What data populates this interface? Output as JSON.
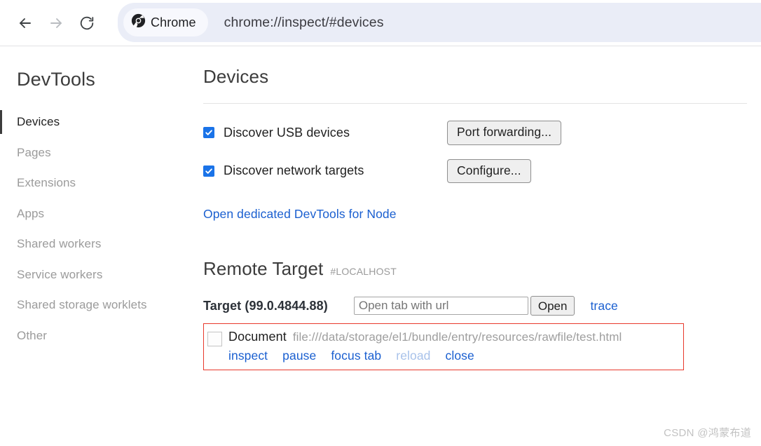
{
  "browser": {
    "back_icon": "arrow-left-icon",
    "forward_icon": "arrow-right-icon",
    "reload_icon": "reload-icon",
    "chrome_chip_label": "Chrome",
    "chrome_logo_icon": "chrome-logo-icon",
    "url": "chrome://inspect/#devices",
    "omnibox_bg": "#eaedf7",
    "chip_bg": "#f7f8fd"
  },
  "sidebar": {
    "brand": "DevTools",
    "items": [
      {
        "label": "Devices",
        "active": true
      },
      {
        "label": "Pages",
        "active": false
      },
      {
        "label": "Extensions",
        "active": false
      },
      {
        "label": "Apps",
        "active": false
      },
      {
        "label": "Shared workers",
        "active": false
      },
      {
        "label": "Service workers",
        "active": false
      },
      {
        "label": "Shared storage worklets",
        "active": false
      },
      {
        "label": "Other",
        "active": false
      }
    ]
  },
  "devices": {
    "title": "Devices",
    "options": [
      {
        "label": "Discover USB devices",
        "checked": true,
        "button": "Port forwarding..."
      },
      {
        "label": "Discover network targets",
        "checked": true,
        "button": "Configure..."
      }
    ],
    "node_link": "Open dedicated DevTools for Node"
  },
  "remote_target": {
    "heading": "Remote Target",
    "host": "#LOCALHOST",
    "target_name": "Target (99.0.4844.88)",
    "url_placeholder": "Open tab with url",
    "url_value": "",
    "open_button": "Open",
    "trace_link": "trace",
    "card": {
      "favicon": "favicon-placeholder-icon",
      "doc_title": "Document",
      "doc_url": "file:///data/storage/el1/bundle/entry/resources/rawfile/test.html",
      "border_color": "#e8392c",
      "actions": [
        {
          "label": "inspect",
          "disabled": false
        },
        {
          "label": "pause",
          "disabled": false
        },
        {
          "label": "focus tab",
          "disabled": false
        },
        {
          "label": "reload",
          "disabled": true
        },
        {
          "label": "close",
          "disabled": false
        }
      ]
    }
  },
  "watermark": "CSDN @鸿蒙布道"
}
